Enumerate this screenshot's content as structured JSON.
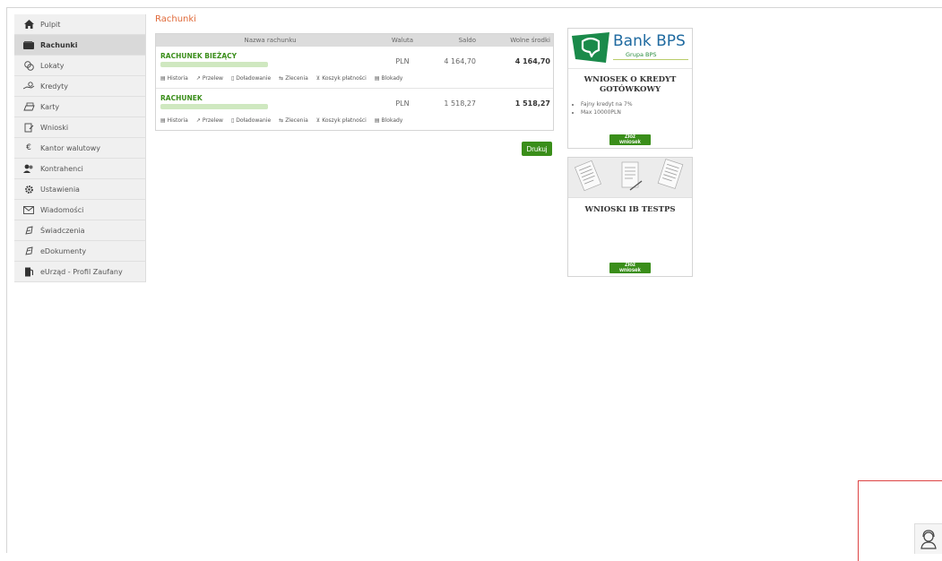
{
  "sidebar": {
    "items": [
      {
        "label": "Pulpit",
        "icon": "home-icon",
        "active": false
      },
      {
        "label": "Rachunki",
        "icon": "wallet-icon",
        "active": true
      },
      {
        "label": "Lokaty",
        "icon": "coins-icon",
        "active": false
      },
      {
        "label": "Kredyty",
        "icon": "hand-money-icon",
        "active": false
      },
      {
        "label": "Karty",
        "icon": "card-icon",
        "active": false
      },
      {
        "label": "Wnioski",
        "icon": "form-icon",
        "active": false
      },
      {
        "label": "Kantor walutowy",
        "icon": "euro-icon",
        "active": false
      },
      {
        "label": "Kontrahenci",
        "icon": "contacts-icon",
        "active": false
      },
      {
        "label": "Ustawienia",
        "icon": "gear-icon",
        "active": false
      },
      {
        "label": "Wiadomości",
        "icon": "envelope-icon",
        "active": false
      },
      {
        "label": "Świadczenia",
        "icon": "benefits-icon",
        "active": false
      },
      {
        "label": "eDokumenty",
        "icon": "edocument-icon",
        "active": false
      },
      {
        "label": "eUrząd - Profil Zaufany",
        "icon": "eoffice-icon",
        "active": false
      }
    ]
  },
  "main": {
    "title": "Rachunki",
    "table": {
      "headers": {
        "name": "Nazwa rachunku",
        "currency": "Waluta",
        "balance": "Saldo",
        "available": "Wolne środki"
      },
      "rows": [
        {
          "name": "RACHUNEK BIEŻĄCY",
          "currency": "PLN",
          "balance": "4 164,70",
          "available": "4 164,70"
        },
        {
          "name": "RACHUNEK",
          "currency": "PLN",
          "balance": "1 518,27",
          "available": "1 518,27"
        }
      ],
      "actions": [
        "Historia",
        "Przelew",
        "Doładowanie",
        "Zlecenia",
        "Koszyk płatności",
        "Blokady"
      ]
    },
    "print_label": "Drukuj"
  },
  "promo": {
    "bank_name": "Bank BPS",
    "bank_sub": "Grupa BPS",
    "card1": {
      "title_line1": "WNIOSEK O KREDYT",
      "title_line2": "GOTÓWKOWY",
      "bullets": [
        "Fajny kredyt na 7%",
        "Max 10000PLN"
      ],
      "button": "Złóż wniosek"
    },
    "card2": {
      "title": "WNIOSKI IB TESTPS",
      "button": "Złóż wniosek"
    }
  },
  "colors": {
    "accent_green": "#3a8e1a",
    "title_orange": "#e06a3a",
    "bps_blue": "#1f6aa0",
    "bps_green": "#2a8c3f"
  }
}
